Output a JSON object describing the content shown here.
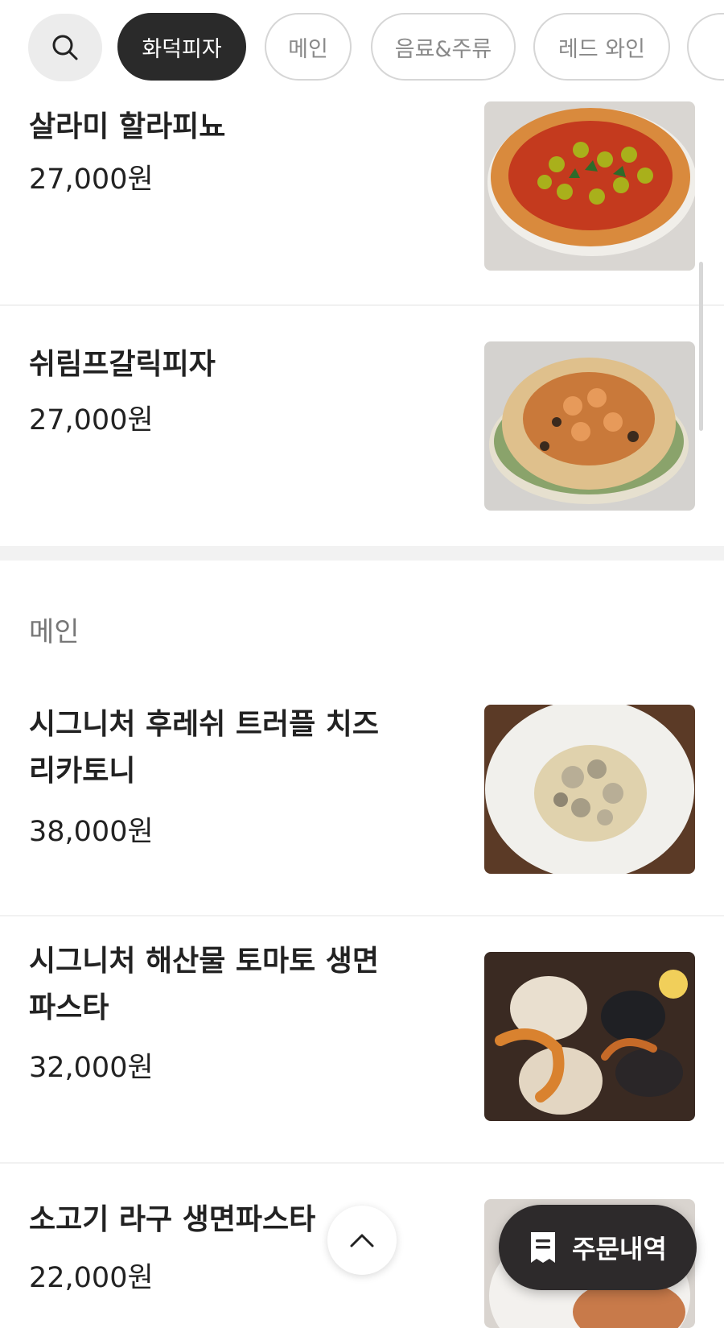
{
  "tabs": {
    "search_icon": "search-icon",
    "items": [
      {
        "label": "화덕피자",
        "active": true
      },
      {
        "label": "메인",
        "active": false
      },
      {
        "label": "음료&주류",
        "active": false
      },
      {
        "label": "레드 와인",
        "active": false
      }
    ]
  },
  "pizza_items": [
    {
      "name": "살라미 할라피뇨",
      "price": "27,000원"
    },
    {
      "name": "쉬림프갈릭피자",
      "price": "27,000원"
    }
  ],
  "main_section": {
    "title": "메인",
    "items": [
      {
        "name_line1": "시그니처 후레쉬 트러플 치즈",
        "name_line2": "리카토니",
        "price": "38,000원"
      },
      {
        "name_line1": "시그니처 해산물 토마토 생면",
        "name_line2": "파스타",
        "price": "32,000원"
      },
      {
        "name_line1": "소고기 라구 생면파스타",
        "price": "22,000원"
      }
    ]
  },
  "floating": {
    "order_history_label": "주문내역",
    "scroll_top_icon": "chevron-up-icon",
    "receipt_icon": "receipt-icon"
  },
  "colors": {
    "active_chip": "#2a2a2a",
    "order_button": "#2d2a2b",
    "chip_border": "#d6d6d6"
  }
}
